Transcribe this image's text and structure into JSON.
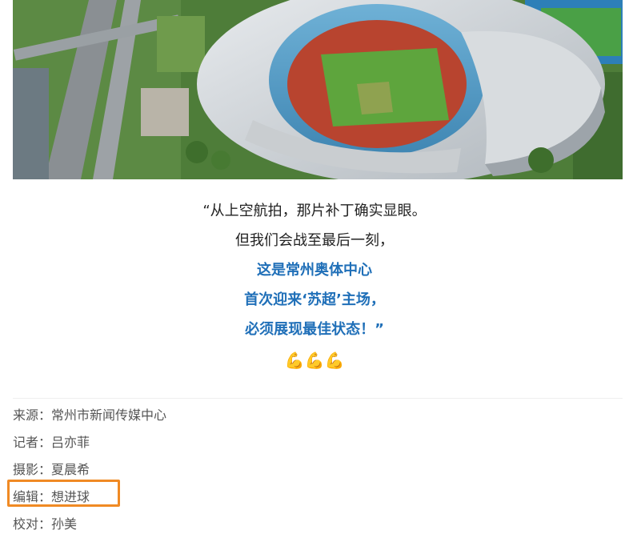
{
  "photo": {
    "description_icon": "stadium-aerial-photo"
  },
  "quote": {
    "line1": "“从上空航拍，那片补丁确实显眼。",
    "line2": "但我们会战至最后一刻，",
    "line3": "这是常州奥体中心",
    "line4": "首次迎来‘苏超’主场，",
    "line5": "必须展现最佳状态！”",
    "emoji": "💪💪💪",
    "accent_color": "#1f6fb8"
  },
  "credits": {
    "source": "来源：常州市新闻传媒中心",
    "reporter": "记者：吕亦菲",
    "photographer": "摄影：夏晨希",
    "editor": "编辑：想进球",
    "proofreader": "校对：孙美",
    "highlight_color": "#f08a24"
  }
}
